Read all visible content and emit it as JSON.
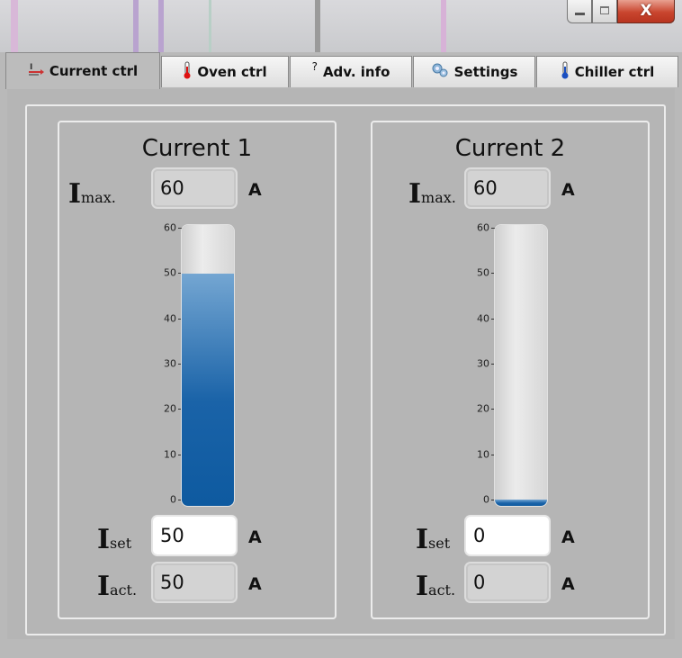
{
  "window": {
    "close_glyph": "X"
  },
  "tabs": [
    {
      "label": "Current ctrl",
      "icon": "current-icon",
      "active": true
    },
    {
      "label": "Oven ctrl",
      "icon": "thermometer-red-icon",
      "active": false
    },
    {
      "label": "Adv. info",
      "icon": "question-icon",
      "active": false
    },
    {
      "label": "Settings",
      "icon": "gears-icon",
      "active": false
    },
    {
      "label": "Chiller ctrl",
      "icon": "thermometer-blue-icon",
      "active": false
    }
  ],
  "scale": {
    "ticks": [
      "60",
      "50",
      "40",
      "30",
      "20",
      "10",
      "0"
    ],
    "min": 0,
    "max": 60
  },
  "channels": [
    {
      "title": "Current 1",
      "imax_label": "I",
      "imax_sub": "max.",
      "imax_value": "60",
      "imax_unit": "A",
      "iset_label": "I",
      "iset_sub": "set",
      "iset_value": "50",
      "iset_unit": "A",
      "iact_label": "I",
      "iact_sub": "act.",
      "iact_value": "50",
      "iact_unit": "A",
      "level": 50
    },
    {
      "title": "Current 2",
      "imax_label": "I",
      "imax_sub": "max.",
      "imax_value": "60",
      "imax_unit": "A",
      "iset_label": "I",
      "iset_sub": "set",
      "iset_value": "0",
      "iset_unit": "A",
      "iact_label": "I",
      "iact_sub": "act.",
      "iact_value": "0",
      "iact_unit": "A",
      "level": 0
    }
  ],
  "colors": {
    "gauge_fill": "#1a63a8",
    "close_button": "#c9452e"
  }
}
